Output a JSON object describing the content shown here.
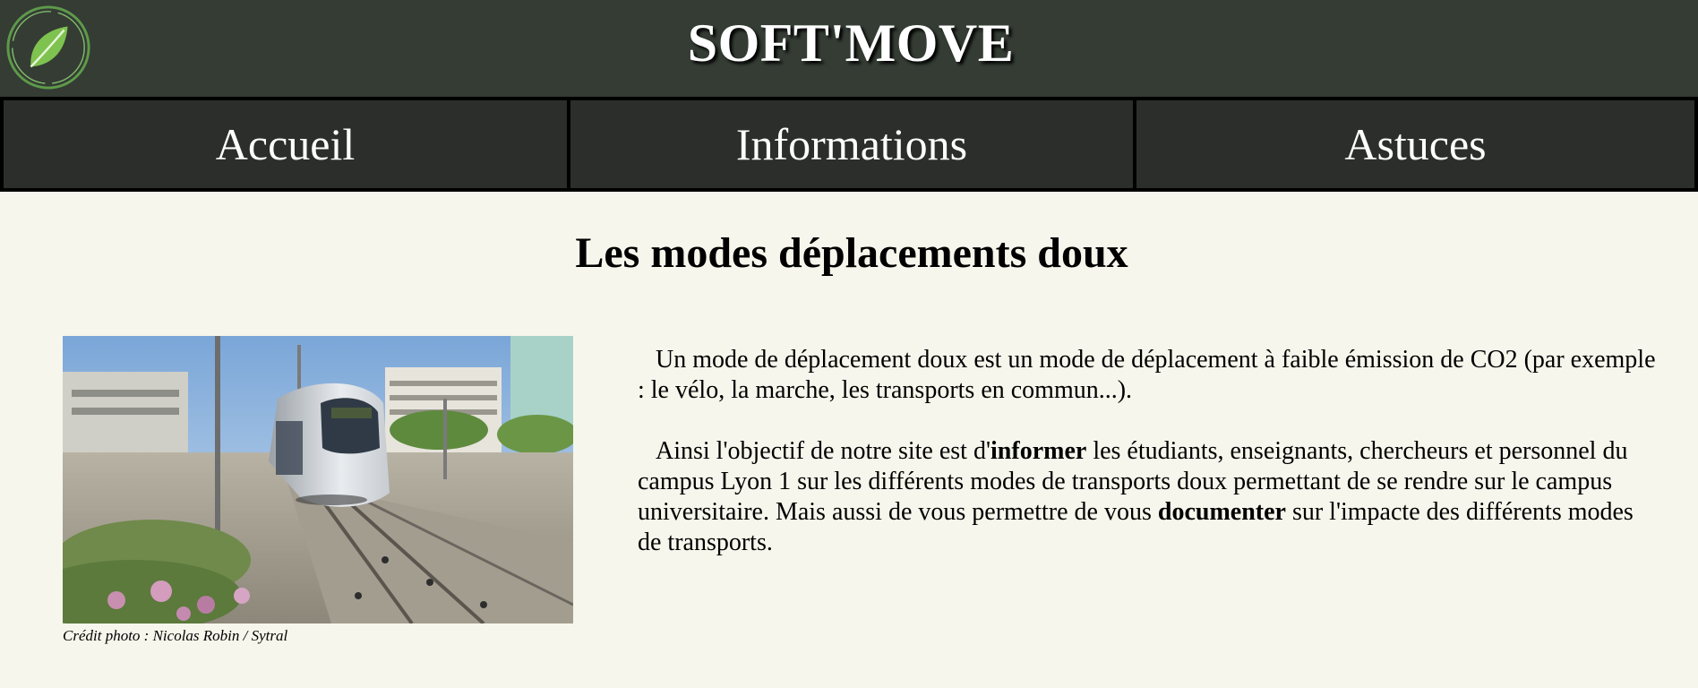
{
  "header": {
    "site_title": "SOFT'MOVE",
    "logo_icon": "leaf-logo-icon",
    "colors": {
      "background": "#343c34",
      "logo_green": "#6fb34a"
    }
  },
  "nav": {
    "items": [
      {
        "label": "Accueil"
      },
      {
        "label": "Informations"
      },
      {
        "label": "Astuces"
      }
    ],
    "colors": {
      "item_bg": "#2b2e2b",
      "border": "#000000"
    }
  },
  "main": {
    "title": "Les modes déplacements doux",
    "photo": {
      "subject": "tram",
      "caption": "Crédit photo : Nicolas Robin / Sytral"
    },
    "paragraphs": [
      {
        "text": "Un mode de déplacement doux est un mode de déplacement à faible émission de CO2 (par exemple : le vélo, la marche, les transports en commun...)."
      },
      {
        "before_1": "Ainsi l'objectif de notre site est d'",
        "bold_1": "informer",
        "middle": " les étudiants, enseignants, chercheurs et personnel du campus Lyon 1 sur les différents modes de transports doux permettant de se rendre sur le campus universitaire. Mais aussi de vous permettre de vous ",
        "bold_2": "documenter",
        "after": " sur l'impacte des différents modes de transports."
      }
    ],
    "background": "#f6f6ec"
  }
}
